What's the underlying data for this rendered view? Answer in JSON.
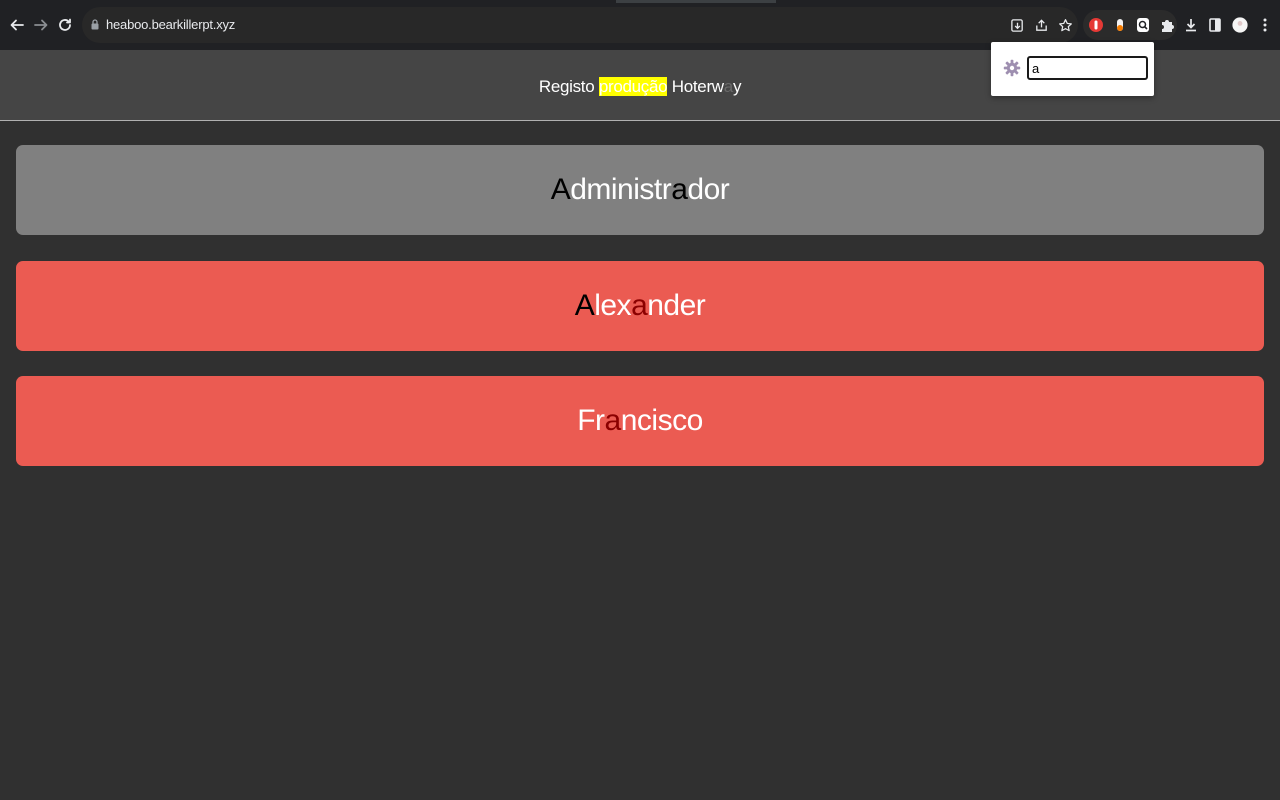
{
  "browser": {
    "url": "heaboo.bearkillerpt.xyz"
  },
  "header": {
    "title_part1": "Registo ",
    "title_highlight": "produção",
    "title_part2": " Hoterw",
    "title_dim": "a",
    "title_part3": "y"
  },
  "cards": [
    {
      "segments": [
        "A",
        "dministr",
        "a",
        "dor"
      ],
      "style": "grey"
    },
    {
      "segments": [
        "A",
        "lex",
        "a",
        "nder"
      ],
      "style": "red"
    },
    {
      "segments": [
        "Fr",
        "a",
        "ncisco"
      ],
      "style": "red"
    }
  ],
  "find_popup": {
    "query": "a"
  },
  "colors": {
    "highlight": "#ffff00",
    "card_grey": "#808080",
    "card_red": "#eb5b52"
  }
}
